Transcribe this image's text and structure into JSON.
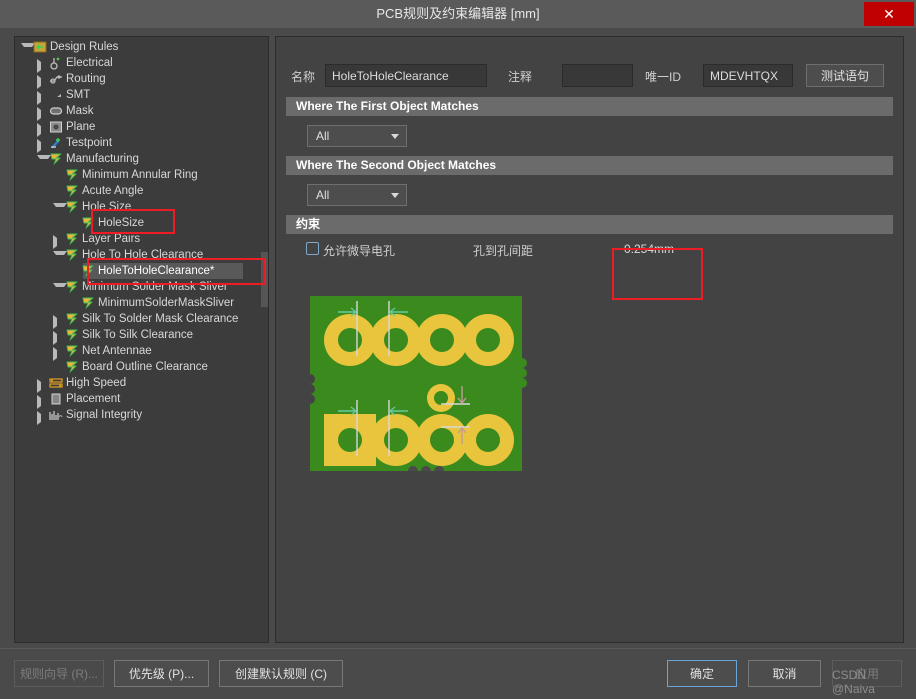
{
  "window": {
    "title": "PCB规则及约束编辑器 [mm]",
    "close_label": "✕"
  },
  "tree": {
    "items": [
      {
        "label": "Design Rules",
        "depth": 0,
        "arrow": "down",
        "icon": "design-rules-icon"
      },
      {
        "label": "Electrical",
        "depth": 1,
        "arrow": "right",
        "icon": "electrical-icon"
      },
      {
        "label": "Routing",
        "depth": 1,
        "arrow": "right",
        "icon": "routing-icon"
      },
      {
        "label": "SMT",
        "depth": 1,
        "arrow": "right",
        "icon": "smt-icon"
      },
      {
        "label": "Mask",
        "depth": 1,
        "arrow": "right",
        "icon": "mask-icon"
      },
      {
        "label": "Plane",
        "depth": 1,
        "arrow": "right",
        "icon": "plane-icon"
      },
      {
        "label": "Testpoint",
        "depth": 1,
        "arrow": "right",
        "icon": "testpoint-icon"
      },
      {
        "label": "Manufacturing",
        "depth": 1,
        "arrow": "down",
        "icon": "rule-icon"
      },
      {
        "label": "Minimum Annular Ring",
        "depth": 2,
        "arrow": "none",
        "icon": "rule-icon"
      },
      {
        "label": "Acute Angle",
        "depth": 2,
        "arrow": "none",
        "icon": "rule-icon"
      },
      {
        "label": "Hole Size",
        "depth": 2,
        "arrow": "down",
        "icon": "rule-icon"
      },
      {
        "label": "HoleSize",
        "depth": 3,
        "arrow": "none",
        "icon": "rule-icon"
      },
      {
        "label": "Layer Pairs",
        "depth": 2,
        "arrow": "right",
        "icon": "rule-icon"
      },
      {
        "label": "Hole To Hole Clearance",
        "depth": 2,
        "arrow": "down",
        "icon": "rule-icon"
      },
      {
        "label": "HoleToHoleClearance*",
        "depth": 3,
        "arrow": "none",
        "icon": "rule-icon",
        "selected": true
      },
      {
        "label": "Minimum Solder Mask Sliver",
        "depth": 2,
        "arrow": "down",
        "icon": "rule-icon"
      },
      {
        "label": "MinimumSolderMaskSliver",
        "depth": 3,
        "arrow": "none",
        "icon": "rule-icon"
      },
      {
        "label": "Silk To Solder Mask Clearance",
        "depth": 2,
        "arrow": "right",
        "icon": "rule-icon"
      },
      {
        "label": "Silk To Silk Clearance",
        "depth": 2,
        "arrow": "right",
        "icon": "rule-icon"
      },
      {
        "label": "Net Antennae",
        "depth": 2,
        "arrow": "right",
        "icon": "rule-icon"
      },
      {
        "label": "Board Outline Clearance",
        "depth": 2,
        "arrow": "none",
        "icon": "rule-icon"
      },
      {
        "label": "High Speed",
        "depth": 1,
        "arrow": "right",
        "icon": "high-speed-icon"
      },
      {
        "label": "Placement",
        "depth": 1,
        "arrow": "right",
        "icon": "placement-icon"
      },
      {
        "label": "Signal Integrity",
        "depth": 1,
        "arrow": "right",
        "icon": "signal-integrity-icon"
      }
    ]
  },
  "form": {
    "name_label": "名称",
    "name_value": "HoleToHoleClearance",
    "comment_label": "注释",
    "comment_value": "",
    "unique_id_label": "唯一ID",
    "unique_id_value": "MDEVHTQX",
    "test_query_button": "测试语句",
    "first_object_header": "Where The First Object Matches",
    "first_object_value": "All",
    "second_object_header": "Where The Second Object Matches",
    "second_object_value": "All",
    "constraints_header": "约束",
    "microvia_checkbox_label": "允许微导电孔",
    "hole_to_hole_label": "孔到孔间距",
    "hole_to_hole_value": "0.254mm"
  },
  "footer": {
    "rule_wizard": "规则向导 (R)...",
    "priority": "优先级 (P)...",
    "create_default_rules": "创建默认规则 (C)",
    "ok": "确定",
    "cancel": "取消",
    "apply": "应用",
    "watermark": "CSDN @Naiva"
  },
  "colors": {
    "accent_red": "#ee1c25",
    "pcb_green": "#3a8a1e",
    "pad_gold": "#e8c53c",
    "title_bg": "#5a5a5a",
    "close_bg": "#c00000"
  }
}
